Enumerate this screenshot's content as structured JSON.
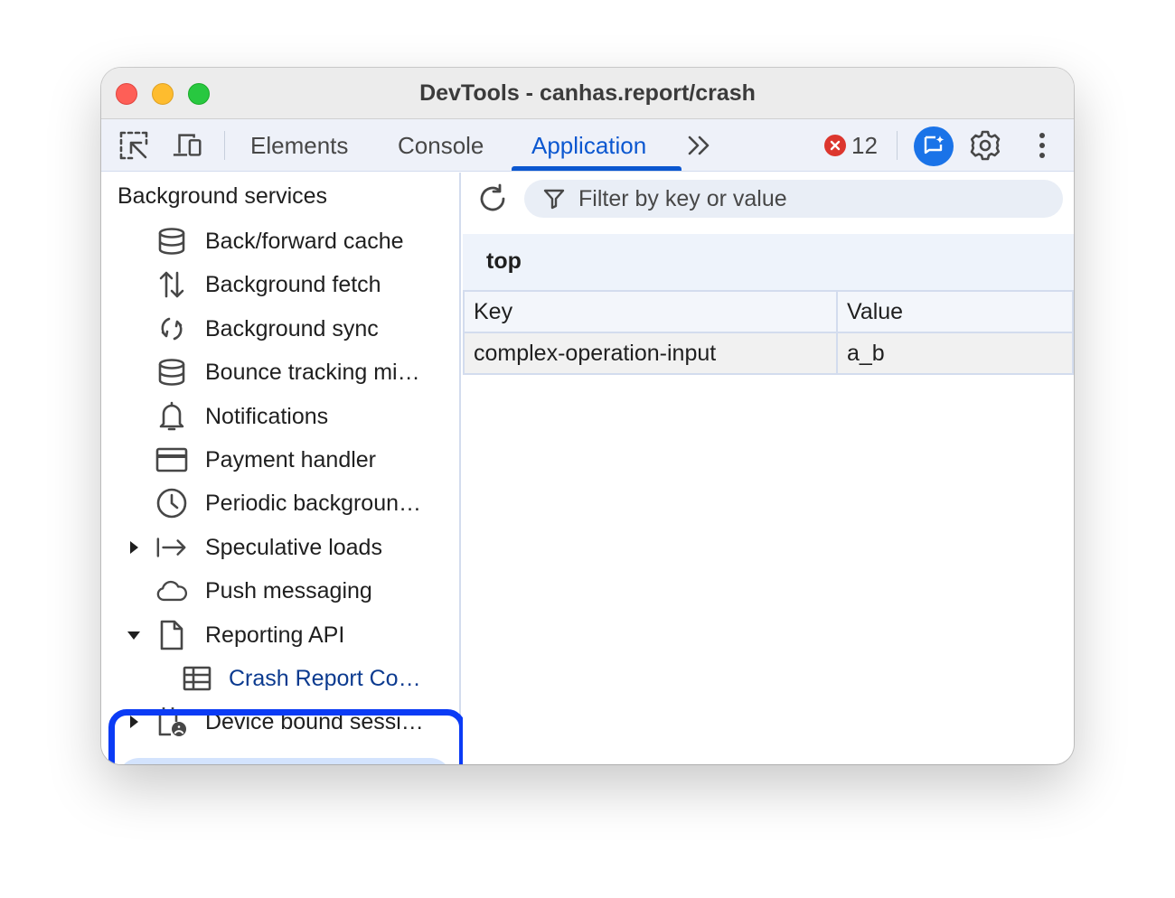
{
  "window": {
    "title": "DevTools - canhas.report/crash"
  },
  "toolbar": {
    "tabs": [
      {
        "label": "Elements",
        "active": false
      },
      {
        "label": "Console",
        "active": false
      },
      {
        "label": "Application",
        "active": true
      }
    ],
    "error_count": "12",
    "icons": [
      "inspect-element-icon",
      "device-toolbar-icon",
      "more-tabs-icon",
      "error-icon",
      "ai-assistance-icon",
      "gear-icon",
      "more-vert-icon"
    ],
    "accent_color": "#0b57d0"
  },
  "sidebar": {
    "section_title": "Background services",
    "items": [
      {
        "label": "Back/forward cache",
        "icon": "database-icon"
      },
      {
        "label": "Background fetch",
        "icon": "up-down-arrows-icon"
      },
      {
        "label": "Background sync",
        "icon": "sync-icon"
      },
      {
        "label": "Bounce tracking mi…",
        "icon": "database-icon"
      },
      {
        "label": "Notifications",
        "icon": "bell-icon"
      },
      {
        "label": "Payment handler",
        "icon": "credit-card-icon"
      },
      {
        "label": "Periodic backgroun…",
        "icon": "clock-icon"
      },
      {
        "label": "Speculative loads",
        "icon": "arrow-right-bar-icon",
        "expandable": true,
        "expanded": false
      },
      {
        "label": "Push messaging",
        "icon": "cloud-icon"
      },
      {
        "label": "Reporting API",
        "icon": "document-icon",
        "expandable": true,
        "expanded": true
      },
      {
        "label": "Crash Report Co…",
        "icon": "table-icon",
        "selected": true
      },
      {
        "label": "Device bound sessi…",
        "icon": "device-session-icon",
        "expandable": true,
        "expanded": false
      }
    ],
    "highlight_color": "#0b3bf5"
  },
  "main": {
    "filter_placeholder": "Filter by key or value",
    "origin": "top",
    "table": {
      "columns": [
        "Key",
        "Value"
      ],
      "rows": [
        [
          "complex-operation-input",
          "a_b"
        ]
      ]
    }
  }
}
